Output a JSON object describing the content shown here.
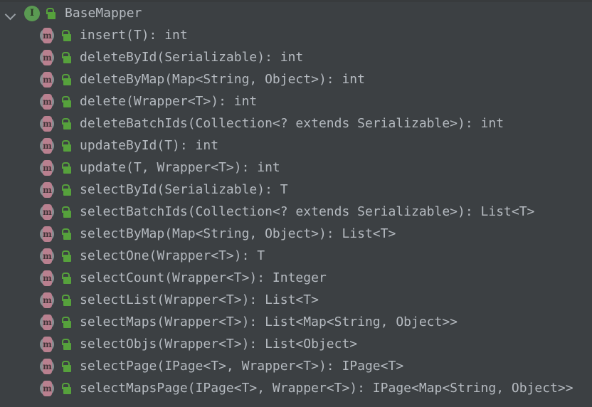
{
  "theme": {
    "background": "#3c4043",
    "top_edge": "#383b3d",
    "text": "#b5bac0",
    "interface_icon": "#5a9a52",
    "method_icon": "#b9808f",
    "lock_icon": "#56a13c",
    "chevron": "#9aa0a6"
  },
  "tree": {
    "header": {
      "chevron_icon": "chevron-down-icon",
      "type_icon": "interface-icon",
      "type_glyph": "I",
      "visibility_icon": "unlocked-public-icon",
      "label": "BaseMapper"
    },
    "members": [
      {
        "icon": "method-icon",
        "glyph": "m",
        "visibility_icon": "unlocked-public-icon",
        "label": "insert(T): int"
      },
      {
        "icon": "method-icon",
        "glyph": "m",
        "visibility_icon": "unlocked-public-icon",
        "label": "deleteById(Serializable): int"
      },
      {
        "icon": "method-icon",
        "glyph": "m",
        "visibility_icon": "unlocked-public-icon",
        "label": "deleteByMap(Map<String, Object>): int"
      },
      {
        "icon": "method-icon",
        "glyph": "m",
        "visibility_icon": "unlocked-public-icon",
        "label": "delete(Wrapper<T>): int"
      },
      {
        "icon": "method-icon",
        "glyph": "m",
        "visibility_icon": "unlocked-public-icon",
        "label": "deleteBatchIds(Collection<? extends Serializable>): int"
      },
      {
        "icon": "method-icon",
        "glyph": "m",
        "visibility_icon": "unlocked-public-icon",
        "label": "updateById(T): int"
      },
      {
        "icon": "method-icon",
        "glyph": "m",
        "visibility_icon": "unlocked-public-icon",
        "label": "update(T, Wrapper<T>): int"
      },
      {
        "icon": "method-icon",
        "glyph": "m",
        "visibility_icon": "unlocked-public-icon",
        "label": "selectById(Serializable): T"
      },
      {
        "icon": "method-icon",
        "glyph": "m",
        "visibility_icon": "unlocked-public-icon",
        "label": "selectBatchIds(Collection<? extends Serializable>): List<T>"
      },
      {
        "icon": "method-icon",
        "glyph": "m",
        "visibility_icon": "unlocked-public-icon",
        "label": "selectByMap(Map<String, Object>): List<T>"
      },
      {
        "icon": "method-icon",
        "glyph": "m",
        "visibility_icon": "unlocked-public-icon",
        "label": "selectOne(Wrapper<T>): T"
      },
      {
        "icon": "method-icon",
        "glyph": "m",
        "visibility_icon": "unlocked-public-icon",
        "label": "selectCount(Wrapper<T>): Integer"
      },
      {
        "icon": "method-icon",
        "glyph": "m",
        "visibility_icon": "unlocked-public-icon",
        "label": "selectList(Wrapper<T>): List<T>"
      },
      {
        "icon": "method-icon",
        "glyph": "m",
        "visibility_icon": "unlocked-public-icon",
        "label": "selectMaps(Wrapper<T>): List<Map<String, Object>>"
      },
      {
        "icon": "method-icon",
        "glyph": "m",
        "visibility_icon": "unlocked-public-icon",
        "label": "selectObjs(Wrapper<T>): List<Object>"
      },
      {
        "icon": "method-icon",
        "glyph": "m",
        "visibility_icon": "unlocked-public-icon",
        "label": "selectPage(IPage<T>, Wrapper<T>): IPage<T>"
      },
      {
        "icon": "method-icon",
        "glyph": "m",
        "visibility_icon": "unlocked-public-icon",
        "label": "selectMapsPage(IPage<T>, Wrapper<T>): IPage<Map<String, Object>>"
      }
    ]
  }
}
